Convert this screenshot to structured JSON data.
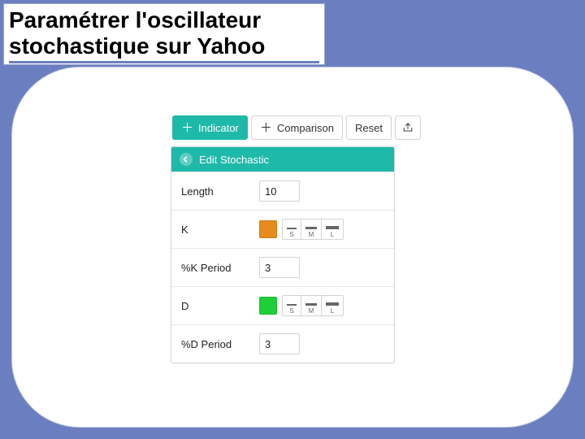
{
  "title": "Paramétrer l'oscillateur stochastique sur Yahoo",
  "toolbar": {
    "indicator": "Indicator",
    "comparison": "Comparison",
    "reset": "Reset"
  },
  "panel": {
    "header": "Edit Stochastic",
    "length": {
      "label": "Length",
      "value": "10"
    },
    "k": {
      "label": "K",
      "color": "#e78b1f",
      "sizes": [
        "S",
        "M",
        "L"
      ]
    },
    "kperiod": {
      "label": "%K Period",
      "value": "3"
    },
    "d": {
      "label": "D",
      "color": "#1fcf3a",
      "sizes": [
        "S",
        "M",
        "L"
      ]
    },
    "dperiod": {
      "label": "%D Period",
      "value": "3"
    }
  }
}
